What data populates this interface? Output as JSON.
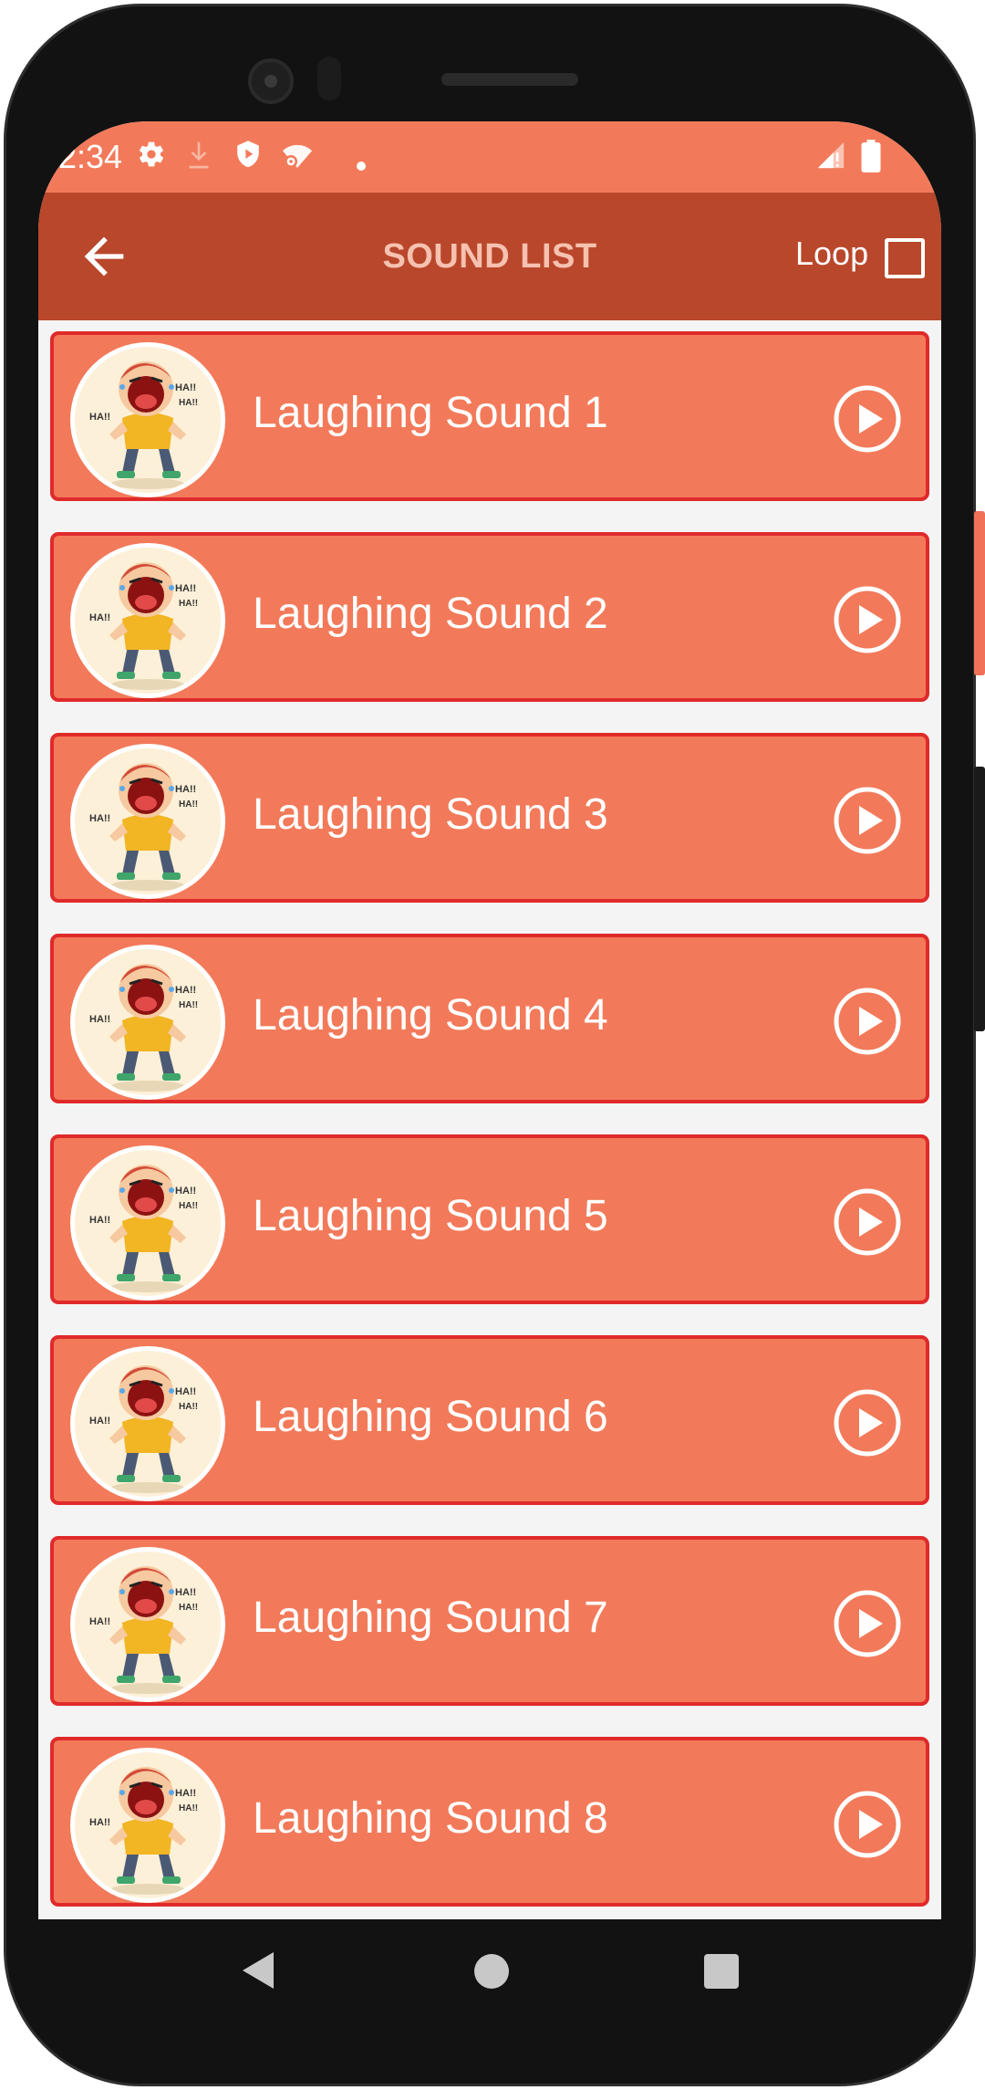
{
  "status_bar": {
    "time": "2:34",
    "icons": [
      "gear-icon",
      "download-icon",
      "shield-icon",
      "wifi-settings-icon",
      "dot-icon",
      "signal-icon",
      "battery-icon"
    ]
  },
  "app_bar": {
    "title": "SOUND LIST",
    "loop_label": "Loop",
    "loop_checked": false,
    "background": "#b9472b"
  },
  "sounds": [
    {
      "label": "Laughing Sound 1"
    },
    {
      "label": "Laughing Sound 2"
    },
    {
      "label": "Laughing Sound 3"
    },
    {
      "label": "Laughing Sound 4"
    },
    {
      "label": "Laughing Sound 5"
    },
    {
      "label": "Laughing Sound 6"
    },
    {
      "label": "Laughing Sound 7"
    },
    {
      "label": "Laughing Sound 8"
    }
  ],
  "colors": {
    "status_bar": "#f27a5a",
    "row": "#f27a5a",
    "row_border": "#e02a2a"
  }
}
